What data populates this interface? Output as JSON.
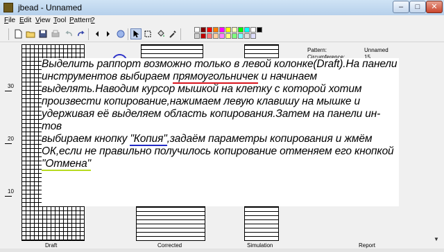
{
  "window": {
    "title": "jbead - Unnamed",
    "min_glyph": "–",
    "max_glyph": "□",
    "close_glyph": "✕"
  },
  "menu": [
    {
      "key": "F",
      "rest": "ile"
    },
    {
      "key": "E",
      "rest": "dit"
    },
    {
      "key": "V",
      "rest": "iew"
    },
    {
      "key": "T",
      "rest": "ool"
    },
    {
      "key": "P",
      "rest": "attern"
    },
    {
      "key": "?",
      "rest": ""
    }
  ],
  "toolbar": {
    "icons": [
      "new-file-icon",
      "open-folder-icon",
      "save-icon",
      "print-icon",
      "undo-icon",
      "redo-icon",
      "arrow-left-icon",
      "arrow-right-icon",
      "zoom-icon",
      "pointer-icon",
      "select-rectangle-icon",
      "fill-icon",
      "color-picker-icon"
    ],
    "highlight_colors": {
      "undo": "#b6da1f",
      "zoom": "#2f34c9",
      "select": "#e01010"
    },
    "palette": [
      "#ffffff",
      "#7f0000",
      "#ff0000",
      "#ff7f00",
      "#ff00ff",
      "#ffff00",
      "#ffffc0",
      "#00ff00",
      "#00ffff",
      "#ffffff",
      "#000000",
      "#d0d0d0",
      "#c00000",
      "#ff8080",
      "#ffd0a0",
      "#ff80ff",
      "#ffff80",
      "#80ff80",
      "#80ffff",
      "#e0e0e0",
      "#e0e0ff"
    ]
  },
  "ruler": {
    "labels": [
      "30",
      "20",
      "10"
    ]
  },
  "report": {
    "rows": [
      {
        "label": "Pattern:",
        "value": "Unnamed"
      },
      {
        "label": "Circumference:",
        "value": "15"
      }
    ]
  },
  "note": {
    "l1": "Выделить раппорт возможно только в левой колонке(Draft).На панели",
    "l2a": "инструментов выбираем ",
    "l2b": "прямоугольничек",
    "l2c": " и начинаем",
    "l3": "выделять.Наводим курсор мышкой на клетку с которой хотим",
    "l4": "произвести копирование,нажимаем левую клавишу на мышке и",
    "l5": "удерживая её выделяем область копирования.Затем на панели ин-тов",
    "l6a": "выбираем кнопку ",
    "l6b": "\"Копия\"",
    "l6c": ",задаём параметры копирования и жмём",
    "l7": "ОК,если не правильно получилось копирование отменяем его кнопкой",
    "l8": "\"Отмена\""
  },
  "panels": {
    "draft": "Draft",
    "corrected": "Corrected",
    "simulation": "Simulation",
    "report": "Report"
  }
}
